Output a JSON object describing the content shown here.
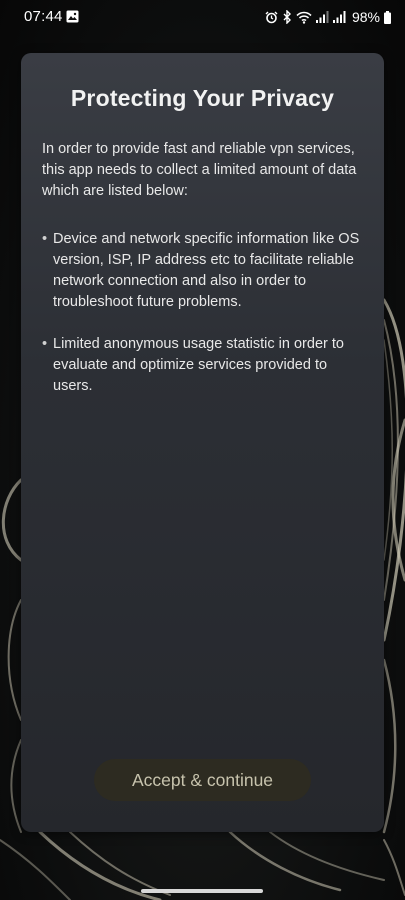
{
  "status_bar": {
    "time": "07:44",
    "battery": "98%",
    "icons": [
      "image-icon",
      "alarm-icon",
      "bluetooth-icon",
      "wifi-icon",
      "signal-icon",
      "signal-icon",
      "battery-icon"
    ]
  },
  "dialog": {
    "title": "Protecting Your Privacy",
    "intro": "In order to provide fast and reliable vpn services, this app needs to collect a limited amount of data which are listed below:",
    "bullets": [
      "Device and network specific information like OS version, ISP, IP address etc to facilitate reliable network connection and also in order to troubleshoot future problems.",
      "Limited anonymous usage statistic in order to evaluate and optimize services provided to users."
    ],
    "accept_label": "Accept & continue"
  },
  "colors": {
    "card_top": "#3a3d44",
    "card_bottom": "#25272c",
    "button_bg": "#2d2b21",
    "button_text": "#c7c3ad"
  }
}
